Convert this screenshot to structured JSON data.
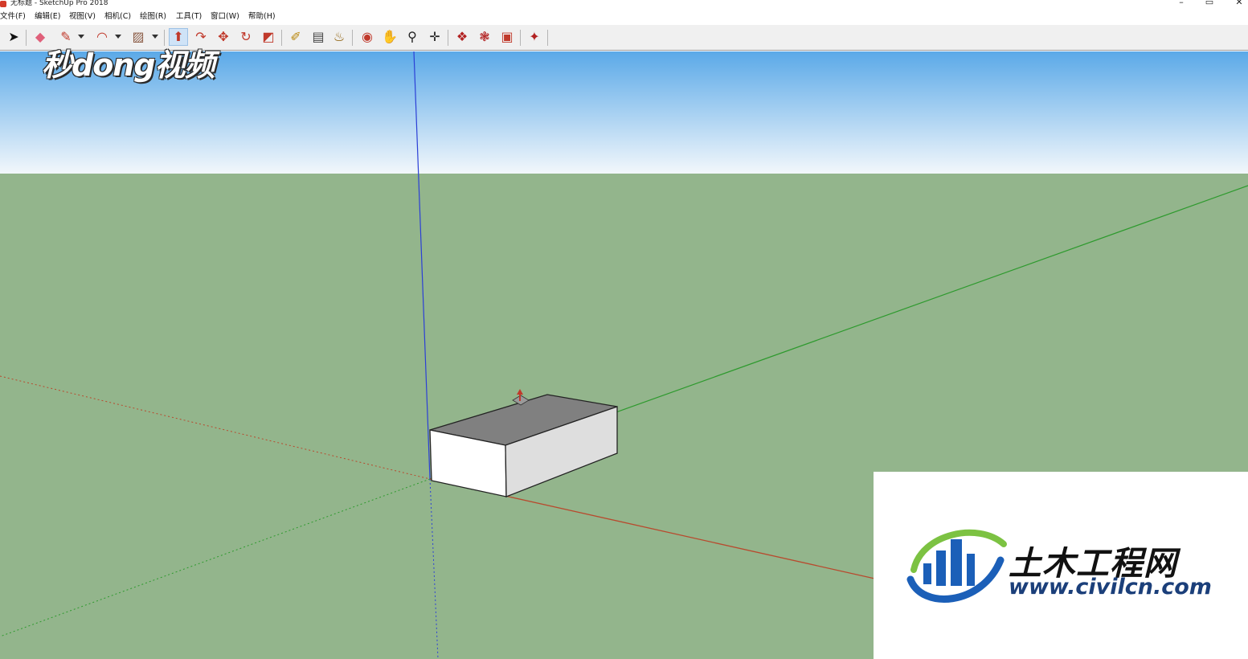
{
  "window": {
    "title": "无标题 - SketchUp Pro 2018",
    "minimize_glyph": "–",
    "restore_glyph": "▭",
    "close_glyph": "✕"
  },
  "menu": {
    "items": [
      {
        "label": "文件(F)"
      },
      {
        "label": "编辑(E)"
      },
      {
        "label": "视图(V)"
      },
      {
        "label": "相机(C)"
      },
      {
        "label": "绘图(R)"
      },
      {
        "label": "工具(T)"
      },
      {
        "label": "窗口(W)"
      },
      {
        "label": "帮助(H)"
      }
    ]
  },
  "toolbar": {
    "tools": [
      {
        "name": "select-tool",
        "icon": "arrow-cursor-icon",
        "glyph": "➤",
        "color": "#111111"
      },
      {
        "name": "eraser-tool",
        "icon": "eraser-icon",
        "glyph": "◆",
        "color": "#e0607a"
      },
      {
        "name": "line-tool",
        "icon": "pencil-icon",
        "glyph": "✎",
        "color": "#c0392b"
      },
      {
        "name": "arc-tool",
        "icon": "arc-icon",
        "glyph": "◠",
        "color": "#c0392b"
      },
      {
        "name": "rectangle-tool",
        "icon": "rectangle-icon",
        "glyph": "▨",
        "color": "#8a5a44"
      },
      {
        "name": "push-pull-tool",
        "icon": "push-pull-icon",
        "glyph": "⬆",
        "color": "#c0392b",
        "active": true
      },
      {
        "name": "offset-tool",
        "icon": "offset-icon",
        "glyph": "↷",
        "color": "#c0392b"
      },
      {
        "name": "move-tool",
        "icon": "move-icon",
        "glyph": "✥",
        "color": "#c0392b"
      },
      {
        "name": "rotate-tool",
        "icon": "rotate-icon",
        "glyph": "↻",
        "color": "#c0392b"
      },
      {
        "name": "scale-tool",
        "icon": "scale-icon",
        "glyph": "◩",
        "color": "#c0392b"
      },
      {
        "name": "tape-measure-tool",
        "icon": "tape-measure-icon",
        "glyph": "✐",
        "color": "#b8860b"
      },
      {
        "name": "text-tool",
        "icon": "text-label-icon",
        "glyph": "▤",
        "color": "#444444"
      },
      {
        "name": "paint-bucket-tool",
        "icon": "paint-bucket-icon",
        "glyph": "♨",
        "color": "#8a5a00"
      },
      {
        "name": "orbit-tool",
        "icon": "orbit-icon",
        "glyph": "◉",
        "color": "#c0392b"
      },
      {
        "name": "pan-tool",
        "icon": "hand-icon",
        "glyph": "✋",
        "color": "#d9a441"
      },
      {
        "name": "zoom-tool",
        "icon": "magnifier-icon",
        "glyph": "⚲",
        "color": "#222222"
      },
      {
        "name": "zoom-extents-tool",
        "icon": "zoom-extents-icon",
        "glyph": "✛",
        "color": "#222222"
      },
      {
        "name": "warehouse-tool",
        "icon": "3d-warehouse-icon",
        "glyph": "❖",
        "color": "#b22222"
      },
      {
        "name": "extension-warehouse-tool",
        "icon": "extension-warehouse-icon",
        "glyph": "❃",
        "color": "#b22222"
      },
      {
        "name": "layout-send-tool",
        "icon": "send-to-layout-icon",
        "glyph": "▣",
        "color": "#c0392b"
      },
      {
        "name": "extension-manager-tool",
        "icon": "extension-manager-icon",
        "glyph": "✦",
        "color": "#b22222"
      }
    ]
  },
  "scene": {
    "sky_top_color": "#5aa9e8",
    "sky_bottom_color": "#f2f7fb",
    "ground_color": "#93b58c",
    "red_axis_color": "#b84a2e",
    "green_axis_color": "#2e9a2e",
    "blue_axis_color": "#2b3fd6",
    "box_top_color": "#808080",
    "box_front_color": "#ffffff",
    "box_side_color": "#dedede"
  },
  "overlays": {
    "brand_logo_text": "秒dong视频",
    "watermark_title": "土木工程网",
    "watermark_url": "www.civilcn.com",
    "watermark_colors": {
      "blue": "#1b5fb8",
      "green": "#7cc242",
      "navy": "#1b3f7a"
    }
  }
}
